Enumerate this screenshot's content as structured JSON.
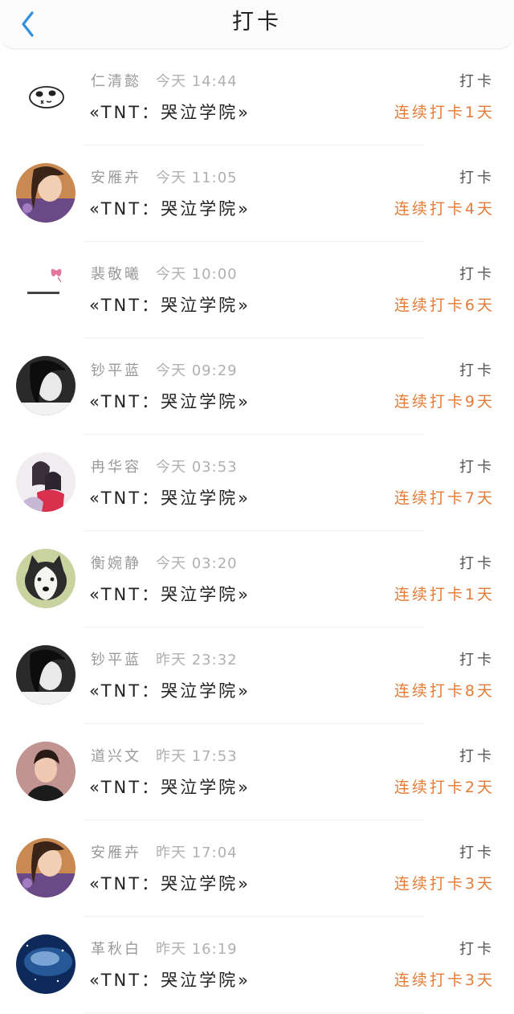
{
  "header": {
    "title": "打卡"
  },
  "colors": {
    "accent": "#e57b37",
    "back": "#2f8fe0"
  },
  "records": [
    {
      "name": "仁清懿",
      "time": "今天 14:44",
      "book": "«TNT：哭泣学院»",
      "action": "打卡",
      "streak": "连续打卡1天",
      "avatar": "panda-sketch"
    },
    {
      "name": "安雁卉",
      "time": "今天 11:05",
      "book": "«TNT：哭泣学院»",
      "action": "打卡",
      "streak": "连续打卡4天",
      "avatar": "girl-photo"
    },
    {
      "name": "裴敬曦",
      "time": "今天 10:00",
      "book": "«TNT：哭泣学院»",
      "action": "打卡",
      "streak": "连续打卡6天",
      "avatar": "butterfly-text"
    },
    {
      "name": "钞平蓝",
      "time": "今天 09:29",
      "book": "«TNT：哭泣学院»",
      "action": "打卡",
      "streak": "连续打卡9天",
      "avatar": "bw-girl-photo"
    },
    {
      "name": "冉华容",
      "time": "今天 03:53",
      "book": "«TNT：哭泣学院»",
      "action": "打卡",
      "streak": "连续打卡7天",
      "avatar": "anime-couple"
    },
    {
      "name": "衡婉静",
      "time": "今天 03:20",
      "book": "«TNT：哭泣学院»",
      "action": "打卡",
      "streak": "连续打卡1天",
      "avatar": "husky-dog"
    },
    {
      "name": "钞平蓝",
      "time": "昨天 23:32",
      "book": "«TNT：哭泣学院»",
      "action": "打卡",
      "streak": "连续打卡8天",
      "avatar": "bw-girl-photo"
    },
    {
      "name": "道兴文",
      "time": "昨天 17:53",
      "book": "«TNT：哭泣学院»",
      "action": "打卡",
      "streak": "连续打卡2天",
      "avatar": "boy-photo"
    },
    {
      "name": "安雁卉",
      "time": "昨天 17:04",
      "book": "«TNT：哭泣学院»",
      "action": "打卡",
      "streak": "连续打卡3天",
      "avatar": "girl-photo"
    },
    {
      "name": "革秋白",
      "time": "昨天 16:19",
      "book": "«TNT：哭泣学院»",
      "action": "打卡",
      "streak": "连续打卡3天",
      "avatar": "galaxy"
    }
  ]
}
